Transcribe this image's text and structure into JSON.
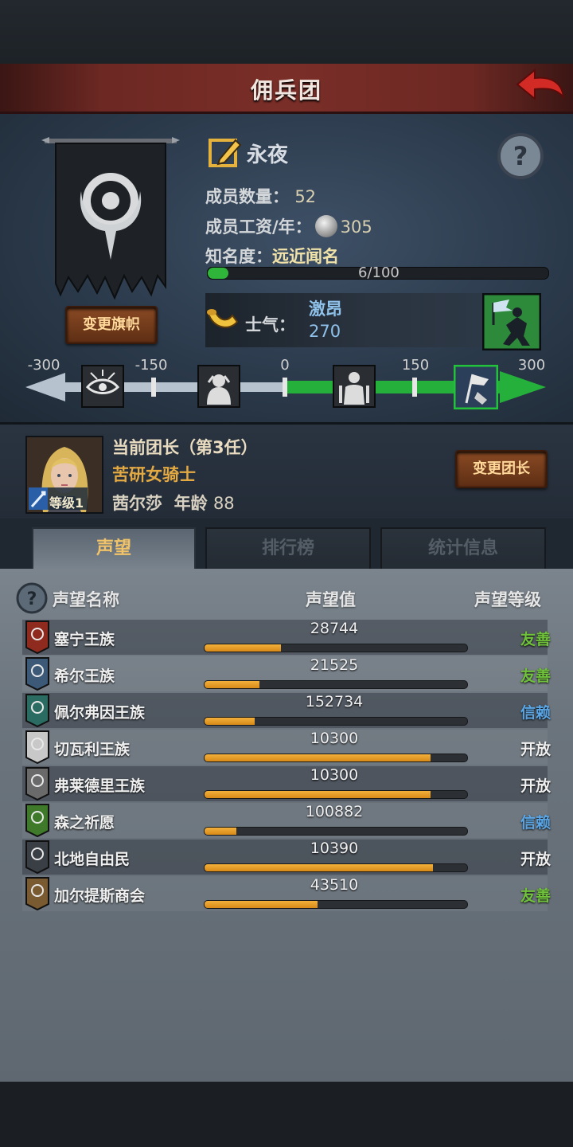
{
  "header": {
    "title": "佣兵团"
  },
  "guild": {
    "name": "永夜",
    "change_banner_label": "变更旗帜",
    "members_label": "成员数量：",
    "members_value": "52",
    "salary_label": "成员工资/年：",
    "salary_value": "305",
    "fame_label": "知名度：",
    "fame_value": "远近闻名",
    "fame_progress_text": "6/100",
    "fame_progress": 0.06,
    "morale_label": "士气：",
    "morale_state": "激昂",
    "morale_value": "270"
  },
  "morale_scale": {
    "ticks": [
      "-300",
      "-150",
      "0",
      "150",
      "300"
    ],
    "value": 270,
    "range": [
      -300,
      300
    ],
    "icons": [
      "despair-eye-icon",
      "distressed-figure-icon",
      "calm-figure-icon",
      "inspired-flag-icon"
    ]
  },
  "leader": {
    "title": "当前团长（第3任）",
    "class": "苦研女骑士",
    "name": "茜尔莎",
    "age_label": "年龄",
    "age_value": "88",
    "level_label": "等级1",
    "change_leader_label": "变更团长"
  },
  "tabs": [
    {
      "label": "声望",
      "active": true
    },
    {
      "label": "排行榜",
      "active": false
    },
    {
      "label": "统计信息",
      "active": false
    }
  ],
  "table": {
    "col_name": "声望名称",
    "col_value": "声望值",
    "col_level": "声望等级",
    "rows": [
      {
        "name": "塞宁王族",
        "value": "28744",
        "progress": 0.29,
        "level": "友善",
        "level_color": "#6fc23a",
        "icon": "red-banner-icon",
        "icon_color": "#8e2a1e"
      },
      {
        "name": "希尔王族",
        "value": "21525",
        "progress": 0.21,
        "level": "友善",
        "level_color": "#6fc23a",
        "icon": "blue-banner-icon",
        "icon_color": "#3c5a78"
      },
      {
        "name": "佩尔弗因王族",
        "value": "152734",
        "progress": 0.19,
        "level": "信赖",
        "level_color": "#5aa6e6",
        "icon": "teal-banner-icon",
        "icon_color": "#2a6b62"
      },
      {
        "name": "切瓦利王族",
        "value": "10300",
        "progress": 0.86,
        "level": "开放",
        "level_color": "#f0f0f0",
        "icon": "white-banner-icon",
        "icon_color": "#c8c8c8"
      },
      {
        "name": "弗莱德里王族",
        "value": "10300",
        "progress": 0.86,
        "level": "开放",
        "level_color": "#f0f0f0",
        "icon": "grey-banner-icon",
        "icon_color": "#6a6a6a"
      },
      {
        "name": "森之祈愿",
        "value": "100882",
        "progress": 0.12,
        "level": "信赖",
        "level_color": "#5aa6e6",
        "icon": "green-banner-icon",
        "icon_color": "#3f7a2a"
      },
      {
        "name": "北地自由民",
        "value": "10390",
        "progress": 0.87,
        "level": "开放",
        "level_color": "#f0f0f0",
        "icon": "dark-banner-icon",
        "icon_color": "#3a3f46"
      },
      {
        "name": "加尔提斯商会",
        "value": "43510",
        "progress": 0.43,
        "level": "友善",
        "level_color": "#6fc23a",
        "icon": "chest-banner-icon",
        "icon_color": "#7a5a30"
      }
    ]
  }
}
